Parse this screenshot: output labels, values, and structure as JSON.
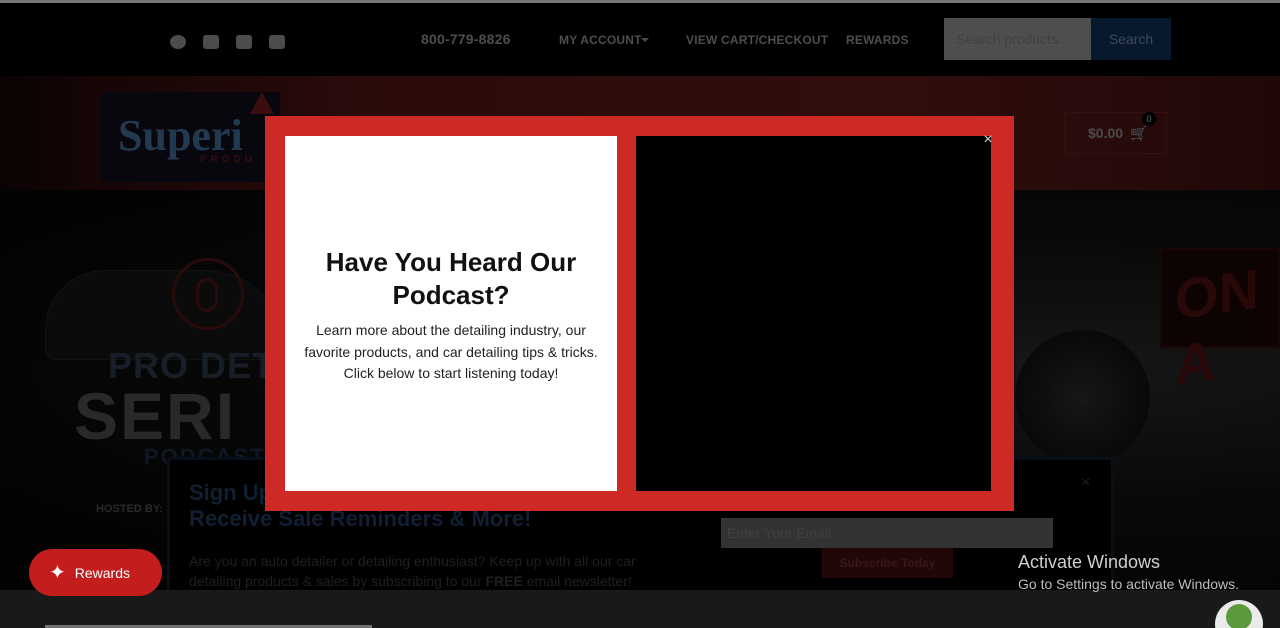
{
  "header": {
    "social": [
      "facebook-icon",
      "twitter-icon",
      "youtube-icon",
      "instagram-icon"
    ],
    "phone": "800-779-8826",
    "my_account": "MY ACCOUNT",
    "view_cart": "VIEW CART/CHECKOUT",
    "rewards": "REWARDS",
    "search_placeholder": "Search products...",
    "search_button": "Search"
  },
  "logo": {
    "text": "Superi",
    "sub": "PRODU"
  },
  "cart": {
    "total": "$0.00",
    "count": "0"
  },
  "hero": {
    "line1": "PRO DETAIL",
    "line2": "SERI",
    "line3": "PODCAST",
    "hosted": "HOSTED BY: JI",
    "on_air": "ON A"
  },
  "newsletter": {
    "title": "Sign Up\nReceive Sale Reminders & More!",
    "body_prefix": "Are you an auto detailer or detailing enthusiast? Keep up with all our car detailing products & sales by subscribing to our ",
    "body_bold": "FREE",
    "body_suffix": " email newsletter!",
    "email_placeholder": "Enter Your Email",
    "subscribe": "Subscribe Today",
    "close": "×"
  },
  "rewards_button": "Rewards",
  "popup": {
    "title": "Have You Heard Our Podcast?",
    "text": "Learn more about the detailing industry, our favorite products, and car detailing tips & tricks. Click below to start listening today!",
    "close": "×"
  },
  "watermark": {
    "title": "Activate Windows",
    "subtitle": "Go to Settings to activate Windows."
  },
  "colors": {
    "modal_red": "#cd2a26",
    "rewards_red": "#c41d1d",
    "search_blue": "#0f2f52"
  }
}
